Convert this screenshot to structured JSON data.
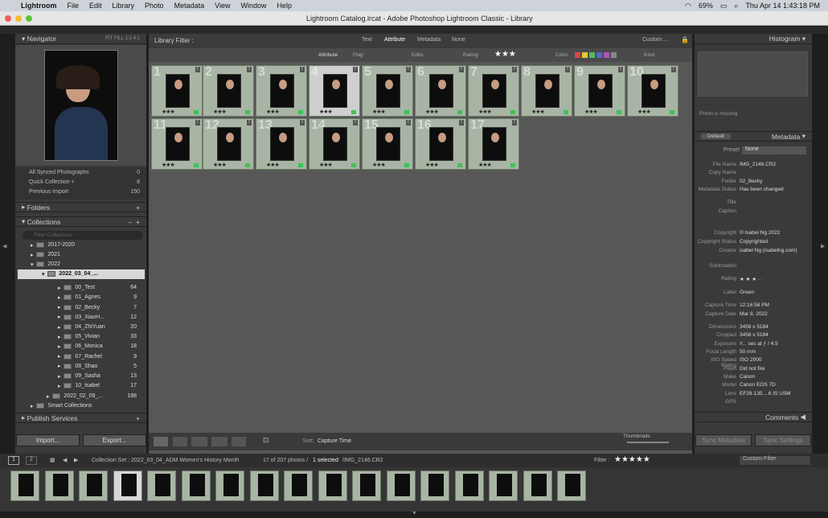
{
  "menubar": {
    "app": "Lightroom",
    "items": [
      "File",
      "Edit",
      "Library",
      "Photo",
      "Metadata",
      "View",
      "Window",
      "Help"
    ],
    "battery": "69%",
    "clock": "Thu Apr 14  1:43:18 PM"
  },
  "window": {
    "title": "Lightroom Catalog.lrcat - Adobe Photoshop Lightroom Classic - Library"
  },
  "navigator": {
    "title": "Navigator",
    "zoom": [
      "FIT",
      "FILL",
      "1:1",
      "4:1"
    ]
  },
  "catalog": [
    {
      "label": "All Synced Photographs",
      "count": "0"
    },
    {
      "label": "Quick Collection +",
      "count": "8"
    },
    {
      "label": "Previous Import",
      "count": "150"
    }
  ],
  "folders": {
    "title": "Folders"
  },
  "collections": {
    "title": "Collections",
    "filter_placeholder": "Filter Collections",
    "years": [
      "2017-2020",
      "2021",
      "2022"
    ],
    "active": "2022_03_04_...",
    "items": [
      {
        "name": "00_Test",
        "count": "64"
      },
      {
        "name": "01_Agnes",
        "count": "9"
      },
      {
        "name": "02_Becky",
        "count": "7"
      },
      {
        "name": "03_XiaoH...",
        "count": "12"
      },
      {
        "name": "04_ZhiYuan",
        "count": "20"
      },
      {
        "name": "05_Vivian",
        "count": "33"
      },
      {
        "name": "06_Monica",
        "count": "18"
      },
      {
        "name": "07_Rachel",
        "count": "9"
      },
      {
        "name": "08_Shao",
        "count": "5"
      },
      {
        "name": "09_Sasha",
        "count": "13"
      },
      {
        "name": "10_Isabel",
        "count": "17"
      }
    ],
    "other": {
      "name": "2022_02_09_...",
      "count": "188"
    },
    "smart": "Smart Collections"
  },
  "publish": {
    "title": "Publish Services"
  },
  "buttons": {
    "import": "Import...",
    "export": "Export...",
    "sync_meta": "Sync Metadata",
    "sync_settings": "Sync Settings"
  },
  "filterbar": {
    "label": "Library Filter :",
    "tabs": [
      "Text",
      "Attribute",
      "Metadata",
      "None"
    ],
    "custom": "Custom ...",
    "attribute": "Attribute",
    "flag": "Flag",
    "edits": "Edits",
    "rating": "Rating",
    "rating_value": "★★★",
    "color": "Color",
    "kind": "Kind"
  },
  "grid": {
    "count_row1": 10,
    "count_row2": 7,
    "selected": 4,
    "stars": "★★★"
  },
  "toolbar": {
    "sort_label": "Sort:",
    "sort_value": "Capture Time",
    "thumbnails": "Thumbnails"
  },
  "histogram": {
    "title": "Histogram",
    "missing": "Photo is missing"
  },
  "metadata": {
    "title": "Metadata",
    "preset_label": "Default",
    "preset": "Preset",
    "preset_value": "None",
    "rows": [
      {
        "k": "File Name",
        "v": "IMG_2146.CR2"
      },
      {
        "k": "Copy Name",
        "v": ""
      },
      {
        "k": "Folder",
        "v": "02_Becky"
      },
      {
        "k": "Metadata Status",
        "v": "Has been changed"
      },
      {
        "k": "Title",
        "v": ""
      },
      {
        "k": "Caption",
        "v": ""
      },
      {
        "k": "Copyright",
        "v": "© Isabel Ng 2022"
      },
      {
        "k": "Copyright Status",
        "v": "Copyrighted"
      },
      {
        "k": "Creator",
        "v": "isabel Ng (isabelng.com)"
      },
      {
        "k": "Sublocation",
        "v": ""
      },
      {
        "k": "Rating",
        "v": "★ ★ ★ ·  ·"
      },
      {
        "k": "Label",
        "v": "Green"
      },
      {
        "k": "Capture Time",
        "v": "12:16:58 PM"
      },
      {
        "k": "Capture Date",
        "v": "Mar 8, 2022"
      },
      {
        "k": "Dimensions",
        "v": "3456 x 5184"
      },
      {
        "k": "Cropped",
        "v": "3456 x 5184"
      },
      {
        "k": "Exposure",
        "v": "¹⁄... sec at ƒ / 4.5"
      },
      {
        "k": "Focal Length",
        "v": "50 mm"
      },
      {
        "k": "ISO Speed Rating",
        "v": "ISO 2000"
      },
      {
        "k": "Flash",
        "v": "Did not fire"
      },
      {
        "k": "Make",
        "v": "Canon"
      },
      {
        "k": "Model",
        "v": "Canon EOS 7D"
      },
      {
        "k": "Lens",
        "v": "EF28-135....6 IS USM"
      },
      {
        "k": "GPS",
        "v": ""
      }
    ]
  },
  "comments": {
    "title": "Comments"
  },
  "status": {
    "pages": [
      "1",
      "2"
    ],
    "path": "Collection Set : 2022_03_04_ADM Women's History Month",
    "count": "17 of 207 photos /",
    "selected": "1 selected",
    "file": "/IMG_2146.CR2",
    "filter_label": "Filter :",
    "filter_stars": "★★★★★",
    "filter_value": "Custom Filter"
  }
}
